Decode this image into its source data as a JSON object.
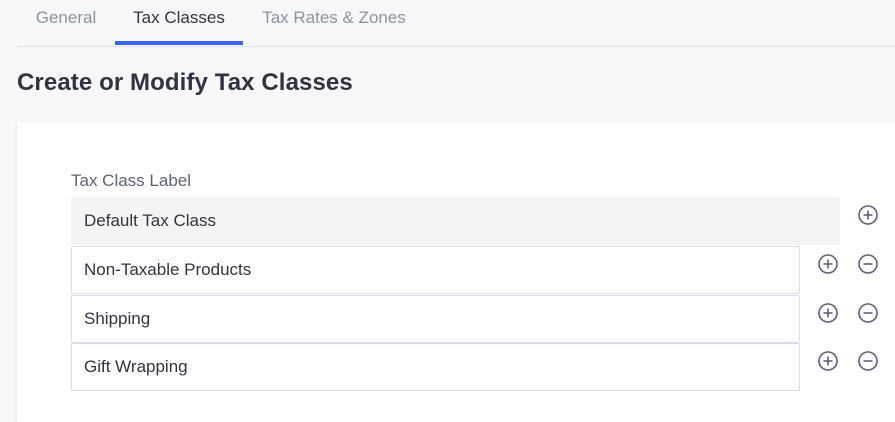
{
  "tabs": [
    {
      "label": "General"
    },
    {
      "label": "Tax Classes"
    },
    {
      "label": "Tax Rates & Zones"
    }
  ],
  "active_tab": "Tax Classes",
  "page_title": "Create or Modify Tax Classes",
  "form": {
    "field_label": "Tax Class Label",
    "rows": [
      {
        "value": "Default Tax Class",
        "editable": false,
        "actions": [
          "add"
        ]
      },
      {
        "value": "Non-Taxable Products",
        "editable": true,
        "actions": [
          "add",
          "remove"
        ]
      },
      {
        "value": "Shipping",
        "editable": true,
        "actions": [
          "add",
          "remove"
        ]
      },
      {
        "value": "Gift Wrapping",
        "editable": true,
        "actions": [
          "add",
          "remove"
        ]
      }
    ]
  },
  "icons": {
    "add": "plus-circle-icon",
    "remove": "minus-circle-icon"
  },
  "colors": {
    "accent": "#3c64f4",
    "background": "#f6f7f9",
    "card": "#ffffff",
    "icon": "#5e637a"
  }
}
